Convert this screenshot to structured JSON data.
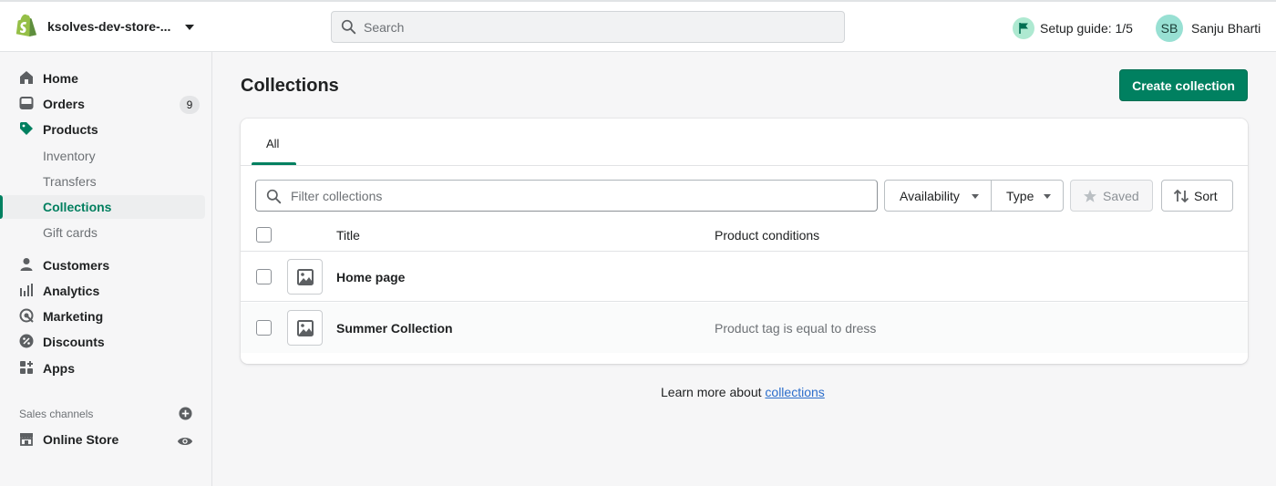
{
  "topbar": {
    "store_name": "ksolves-dev-store-...",
    "search_placeholder": "Search",
    "setup_guide": "Setup guide: 1/5",
    "user_initials": "SB",
    "user_name": "Sanju Bharti"
  },
  "sidebar": {
    "items": [
      {
        "label": "Home",
        "icon": "home-icon"
      },
      {
        "label": "Orders",
        "icon": "orders-icon",
        "badge": "9"
      },
      {
        "label": "Products",
        "icon": "tag-icon"
      },
      {
        "label": "Inventory"
      },
      {
        "label": "Transfers"
      },
      {
        "label": "Collections",
        "active": true
      },
      {
        "label": "Gift cards"
      },
      {
        "label": "Customers",
        "icon": "person-icon"
      },
      {
        "label": "Analytics",
        "icon": "bar-chart-icon"
      },
      {
        "label": "Marketing",
        "icon": "target-icon"
      },
      {
        "label": "Discounts",
        "icon": "discount-icon"
      },
      {
        "label": "Apps",
        "icon": "apps-icon"
      }
    ],
    "sales_channels_label": "Sales channels",
    "online_store_label": "Online Store"
  },
  "main": {
    "page_title": "Collections",
    "create_button": "Create collection",
    "tabs": [
      {
        "label": "All",
        "active": true
      }
    ],
    "filter_placeholder": "Filter collections",
    "filters": {
      "availability": "Availability",
      "type": "Type",
      "saved": "Saved",
      "sort": "Sort"
    },
    "table": {
      "columns": [
        "Title",
        "Product conditions"
      ],
      "rows": [
        {
          "title": "Home page",
          "conditions": ""
        },
        {
          "title": "Summer Collection",
          "conditions": "Product tag is equal to dress"
        }
      ]
    },
    "learn_more": {
      "prefix": "Learn more about ",
      "link": "collections"
    }
  },
  "colors": {
    "brand_green": "#008060",
    "link_blue": "#2c6ecb",
    "avatar_bg": "#98e0d3"
  }
}
